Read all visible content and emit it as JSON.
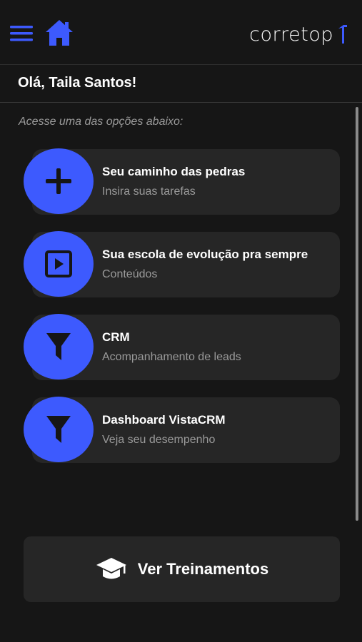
{
  "colors": {
    "accent": "#3d5afe",
    "background": "#161616",
    "card": "#262626",
    "muted": "#9a9a9a"
  },
  "header": {
    "menu_icon": "hamburger-menu-icon",
    "home_icon": "home-icon",
    "logo_text": "corretop"
  },
  "greeting": "Olá, Taila Santos!",
  "subtitle": "Acesse uma das opções abaixo:",
  "options": [
    {
      "icon": "plus-icon",
      "title": "Seu caminho das pedras",
      "description": "Insira suas tarefas"
    },
    {
      "icon": "play-square-icon",
      "title": "Sua escola de evolução pra sempre",
      "description": "Conteúdos"
    },
    {
      "icon": "filter-icon",
      "title": "CRM",
      "description": "Acompanhamento de leads"
    },
    {
      "icon": "filter-icon",
      "title": "Dashboard VistaCRM",
      "description": "Veja seu desempenho"
    }
  ],
  "training_button": {
    "icon": "graduation-cap-icon",
    "label": "Ver Treinamentos"
  }
}
